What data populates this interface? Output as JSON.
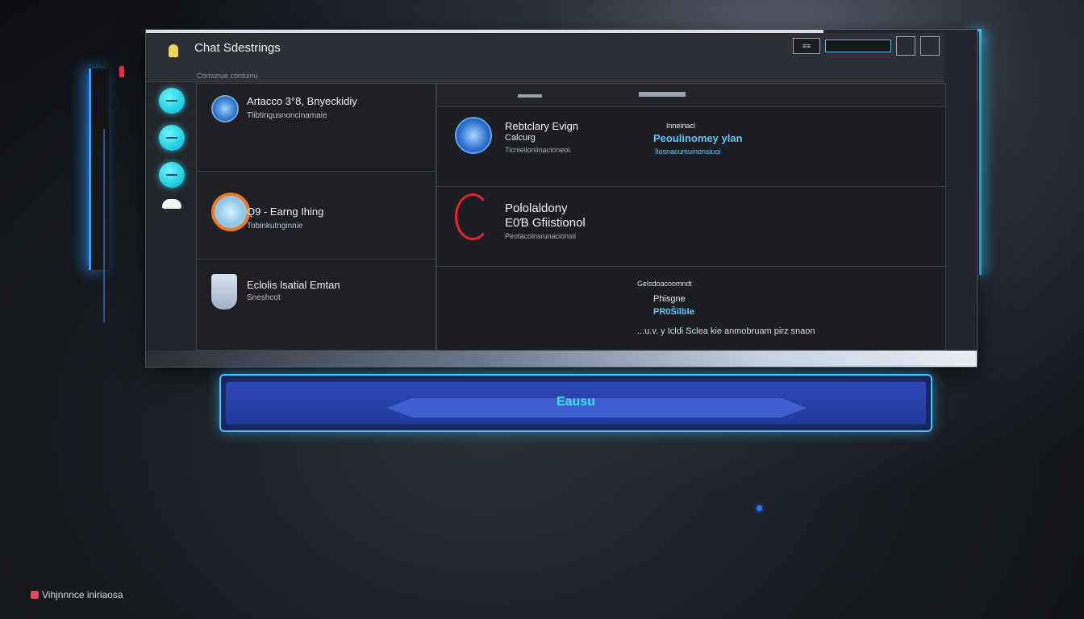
{
  "window": {
    "title": "Chat Sdestrings",
    "subtitle": "Comunue contuinu"
  },
  "titlebar": {
    "search_placeholder": "",
    "btn_label": "≡≡"
  },
  "sidebar": {
    "items": [
      {
        "icon": "chat-icon"
      },
      {
        "icon": "contacts-icon"
      },
      {
        "icon": "settings-icon"
      },
      {
        "icon": "cloud-icon"
      }
    ]
  },
  "list": {
    "items": [
      {
        "title": "Artacco 3°8, Bnyeckidiy",
        "subtitle": "Tlibtingusnoncinamaie",
        "icon": "globe-icon"
      },
      {
        "title": "Ǫ9 - Earng Ihing",
        "subtitle": "Tobinkutnginnie",
        "icon": "orange-ring-icon"
      },
      {
        "title": "Eclolis lsatial Emtan",
        "subtitle": "Sneshcot",
        "icon": "cup-icon"
      }
    ]
  },
  "detail": {
    "row1": {
      "title": "Rebtclary Evign",
      "title_line2": "Calcurg",
      "subtitle": "Ticnieiloniinacioneoi.",
      "right_label": "Inneinacl",
      "right_value": "Peoulinomey ylan",
      "right_sub": "Ilosnacumuinonsiuoi"
    },
    "row2": {
      "title": "Pololaldony",
      "title_line2": "E0Ɓ Gfiistionol",
      "subtitle": "Peotacolnsrunacionsti"
    },
    "row3": {
      "label": "Gelsdoacoomndt",
      "value1": "Phisgne",
      "value2": "PR0Ŝilble",
      "note": "...u.v. y Icldi Sclea kie anmobruam pirz snaon"
    }
  },
  "main_button": {
    "label": "Eausu"
  },
  "footer": {
    "text": "Vihjnnnce iniriaosa"
  }
}
